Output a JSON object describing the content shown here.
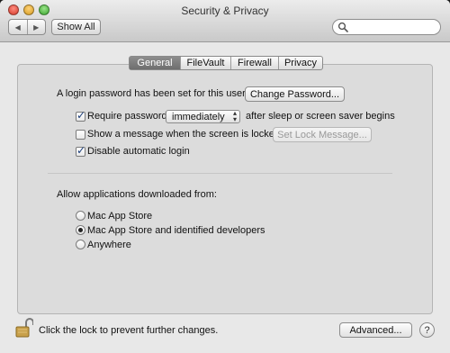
{
  "window": {
    "title": "Security & Privacy"
  },
  "toolbar": {
    "show_all_label": "Show All",
    "back_icon": "◀",
    "forward_icon": "▶",
    "search_placeholder": ""
  },
  "tabs": [
    {
      "label": "General",
      "active": true
    },
    {
      "label": "FileVault",
      "active": false
    },
    {
      "label": "Firewall",
      "active": false
    },
    {
      "label": "Privacy",
      "active": false
    }
  ],
  "general": {
    "login_password_text": "A login password has been set for this user",
    "change_password_label": "Change Password...",
    "require_password": {
      "label": "Require password",
      "checked": true,
      "popup_value": "immediately",
      "suffix": "after sleep or screen saver begins"
    },
    "show_message": {
      "label": "Show a message when the screen is locked",
      "checked": false,
      "button_label": "Set Lock Message..."
    },
    "disable_autologin": {
      "label": "Disable automatic login",
      "checked": true
    }
  },
  "allow_apps": {
    "heading": "Allow applications downloaded from:",
    "options": [
      {
        "label": "Mac App Store",
        "selected": false
      },
      {
        "label": "Mac App Store and identified developers",
        "selected": true
      },
      {
        "label": "Anywhere",
        "selected": false
      }
    ]
  },
  "footer": {
    "lock_text": "Click the lock to prevent further changes.",
    "advanced_label": "Advanced...",
    "help_label": "?"
  }
}
